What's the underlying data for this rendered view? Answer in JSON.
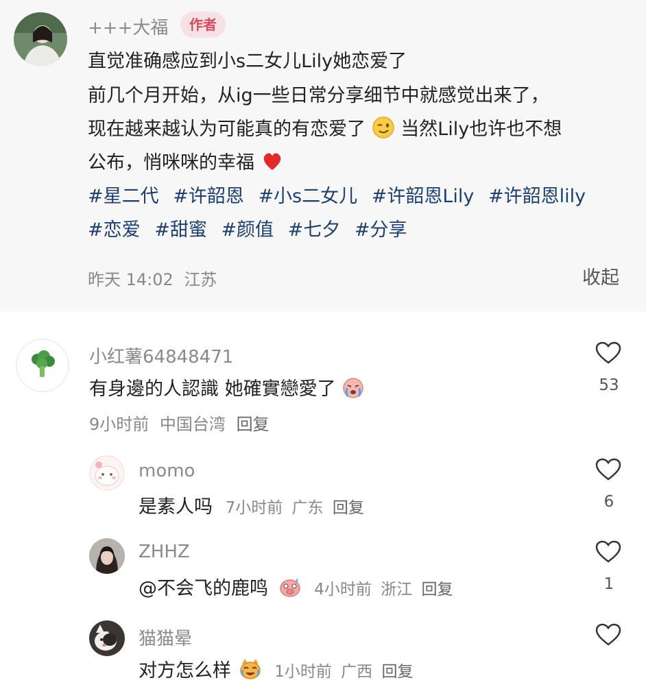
{
  "author_post": {
    "username": "+++大福",
    "badge": "作者",
    "lines": [
      "直觉准确感应到小s二女儿Lily她恋爱了",
      "前几个月开始，从ig一些日常分享细节中就感觉出来了，",
      "现在越来越认为可能真的有恋爱了",
      "当然Lily也许也不想",
      "公布，悄咪咪的幸福"
    ],
    "tags_row1": [
      "#星二代",
      "#许韶恩",
      "#小s二女儿",
      "#许韶恩Lily",
      "#许韶恩lily"
    ],
    "tags_row2": [
      "#恋爱",
      "#甜蜜",
      "#颜值",
      "#七夕",
      "#分享"
    ],
    "time": "昨天 14:02",
    "location": "江苏",
    "collapse_label": "收起"
  },
  "comments": [
    {
      "username": "小红薯64848471",
      "text": "有身邊的人認識 她確實戀愛了",
      "time": "9小时前",
      "location": "中国台湾",
      "reply": "回复",
      "likes": "53"
    },
    {
      "username": "momo",
      "text": "是素人吗",
      "time": "7小时前",
      "location": "广东",
      "reply": "回复",
      "likes": "6"
    },
    {
      "username": "ZHHZ",
      "text": "@不会飞的鹿鸣",
      "time": "4小时前",
      "location": "浙江",
      "reply": "回复",
      "likes": "1"
    },
    {
      "username": "猫猫晕",
      "text": "对方怎么样",
      "time": "1小时前",
      "location": "广西",
      "reply": "回复",
      "likes": ""
    }
  ],
  "icons": {
    "like": "heart-outline-icon",
    "wink": "wink-emoji-icon",
    "heart": "red-heart-emoji-icon",
    "cry": "crying-emoji-icon",
    "pig": "pig-sweat-emoji-icon",
    "cat": "cat-laugh-emoji-icon"
  },
  "colors": {
    "badge_bg": "#f6e2e5",
    "badge_text": "#d44a5e",
    "hashtag": "#1d3f6e",
    "meta": "#888888"
  }
}
